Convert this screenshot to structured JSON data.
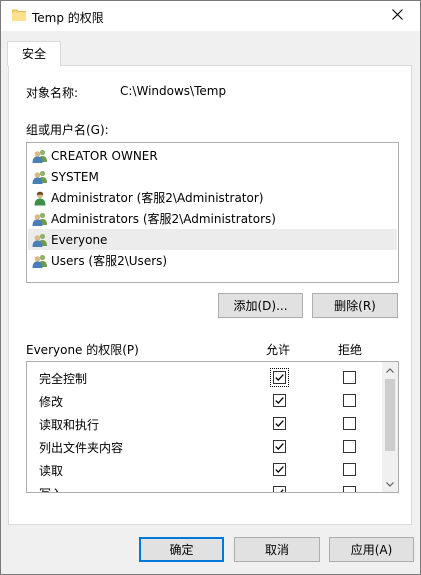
{
  "window": {
    "title": "Temp 的权限",
    "close_icon": "close-icon"
  },
  "tabs": [
    {
      "label": "安全",
      "selected": true
    }
  ],
  "object": {
    "label": "对象名称:",
    "value": "C:\\Windows\\Temp"
  },
  "users": {
    "label": "组或用户名(G):",
    "items": [
      {
        "name": "CREATOR OWNER",
        "icon": "group-icon",
        "selected": false
      },
      {
        "name": "SYSTEM",
        "icon": "group-icon",
        "selected": false
      },
      {
        "name": "Administrator (客服2\\Administrator)",
        "icon": "user-icon",
        "selected": false
      },
      {
        "name": "Administrators (客服2\\Administrators)",
        "icon": "group-icon",
        "selected": false
      },
      {
        "name": "Everyone",
        "icon": "group-icon",
        "selected": true
      },
      {
        "name": "Users (客服2\\Users)",
        "icon": "group-icon",
        "selected": false
      }
    ]
  },
  "buttons": {
    "add": "添加(D)...",
    "remove": "删除(R)",
    "ok": "确定",
    "cancel": "取消",
    "apply": "应用(A)"
  },
  "permissions": {
    "label": "Everyone 的权限(P)",
    "allow_header": "允许",
    "deny_header": "拒绝",
    "items": [
      {
        "name": "完全控制",
        "allow": true,
        "deny": false
      },
      {
        "name": "修改",
        "allow": true,
        "deny": false
      },
      {
        "name": "读取和执行",
        "allow": true,
        "deny": false
      },
      {
        "name": "列出文件夹内容",
        "allow": true,
        "deny": false
      },
      {
        "name": "读取",
        "allow": true,
        "deny": false
      },
      {
        "name": "写入",
        "allow": true,
        "deny": false
      }
    ]
  },
  "colors": {
    "accent": "#0078d7",
    "selection": "#ececec",
    "folder": "#f8d775"
  }
}
